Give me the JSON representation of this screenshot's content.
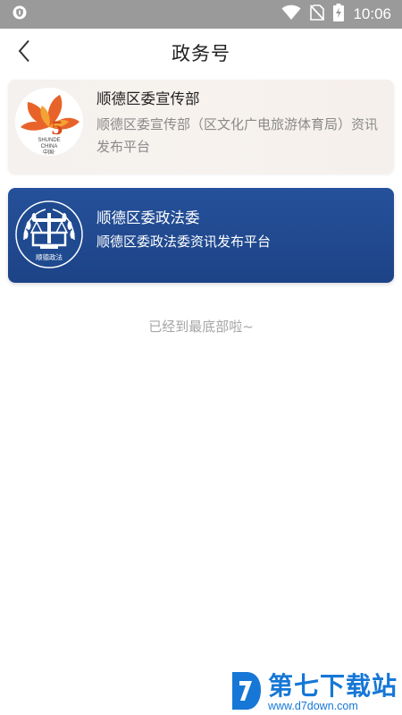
{
  "status_bar": {
    "time": "10:06",
    "icons": [
      "shield-icon",
      "wifi-icon",
      "no-sim-icon",
      "battery-charging-icon"
    ]
  },
  "nav": {
    "title": "政务号",
    "back_icon": "chevron-left-icon"
  },
  "cards": [
    {
      "title": "顺德区委宣传部",
      "description": "顺德区委宣传部（区文化广电旅游体育局）资讯发布平台",
      "logo_text": "SHUNDE CHINA",
      "logo_subtext": "中国·",
      "logo_icon": "orange-flower-logo-icon"
    },
    {
      "title": "顺德区委政法委",
      "description": "顺德区委政法委资讯发布平台",
      "logo_text": "顺德政法",
      "logo_icon": "justice-scale-logo-icon"
    }
  ],
  "end_text": "已经到最底部啦~",
  "watermark": {
    "main": "第七下载站",
    "url": "www.d7down.com"
  },
  "colors": {
    "status_bar": "#9a9a9a",
    "card_blue": "#224c94",
    "muted_text": "#8a8a8a",
    "watermark_blue": "#1677d6"
  }
}
